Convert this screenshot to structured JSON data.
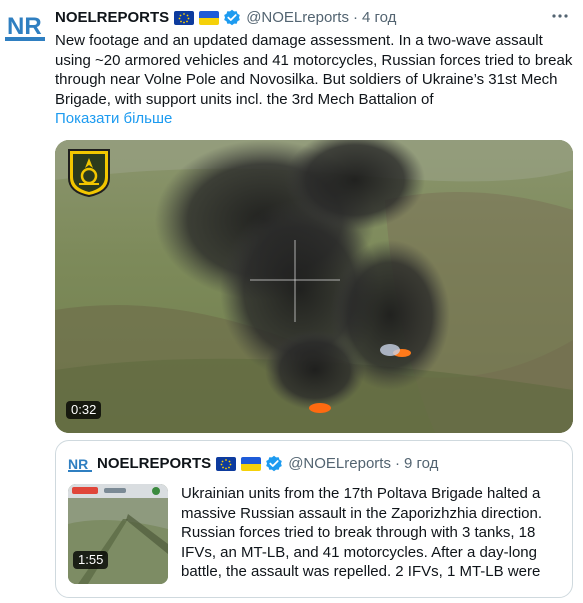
{
  "account": {
    "name": "NOELREPORTS",
    "avatar_text": "NR",
    "handle": "@NOELreports",
    "separator": "·",
    "time": "4 год"
  },
  "tweet": {
    "text": "New footage and an updated damage assessment. In a two-wave assault using ~20 armored vehicles and 41 motorcycles, Russian forces tried to break through near Volne Pole and Novosilka. But soldiers of Ukraine’s 31st Mech Brigade, with support units incl. the 3rd Mech Battalion of",
    "show_more": "Показати більше"
  },
  "media": {
    "duration": "0:32",
    "overlay_icon": "brigade-emblem-icon"
  },
  "quoted": {
    "name": "NOELREPORTS",
    "handle": "@NOELreports",
    "separator": "·",
    "time": "9 год",
    "text": "Ukrainian units from the 17th Poltava Brigade halted a massive Russian assault in the Zaporizhzhia direction. Russian forces tried to break through with 3 tanks, 18 IFVs, an MT-LB, and 41 motorcycles. After a day-long battle, the assault was repelled. 2 IFVs, 1 MT-LB were",
    "duration": "1:55"
  },
  "icons": {
    "more": "more-options-icon",
    "verified": "verified-badge-icon",
    "eu_flag": "eu-flag-icon",
    "ua_flag": "ukraine-flag-icon"
  },
  "colors": {
    "link": "#1d9bf0",
    "verified": "#1d9bf0",
    "secondary_text": "#536471",
    "avatar_blue": "#2f7fc1"
  }
}
